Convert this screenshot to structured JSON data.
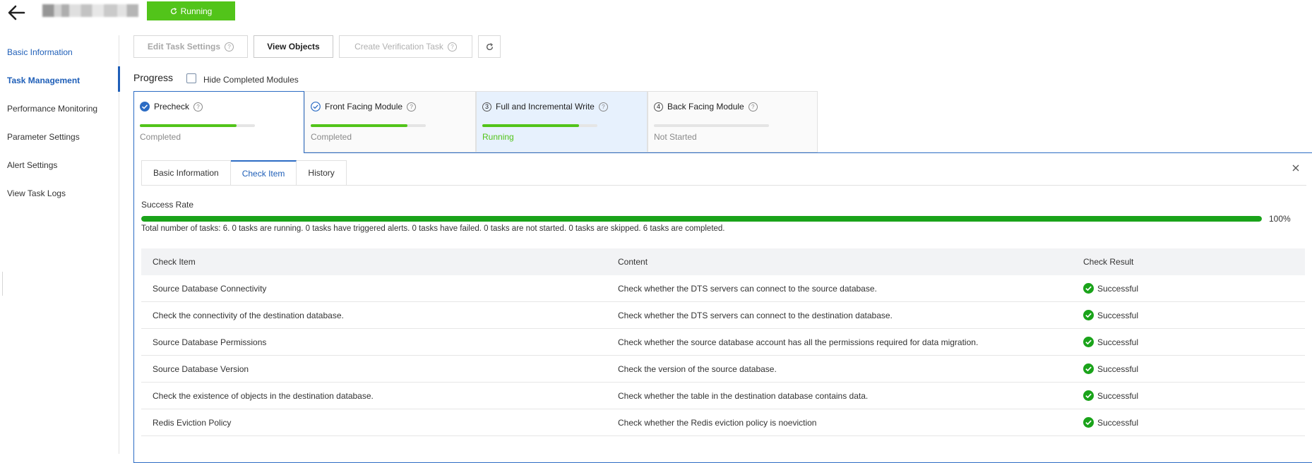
{
  "header": {
    "status": "Running"
  },
  "sidebar": {
    "items": [
      {
        "label": "Basic Information"
      },
      {
        "label": "Task Management"
      },
      {
        "label": "Performance Monitoring"
      },
      {
        "label": "Parameter Settings"
      },
      {
        "label": "Alert Settings"
      },
      {
        "label": "View Task Logs"
      }
    ]
  },
  "toolbar": {
    "edit_label": "Edit Task Settings",
    "view_label": "View Objects",
    "create_label": "Create Verification Task"
  },
  "progress": {
    "title": "Progress",
    "hide_label": "Hide Completed Modules",
    "hide_checked": false,
    "steps": [
      {
        "label": "Precheck",
        "status": "Completed",
        "percent": 100
      },
      {
        "label": "Front Facing Module",
        "status": "Completed",
        "percent": 100
      },
      {
        "number": "3",
        "label": "Full and Incremental Write",
        "status": "Running",
        "percent": 100
      },
      {
        "number": "4",
        "label": "Back Facing Module",
        "status": "Not Started",
        "percent": 0
      }
    ]
  },
  "panel": {
    "tabs": [
      "Basic Information",
      "Check Item",
      "History"
    ],
    "active_tab": "Check Item",
    "success_rate_label": "Success Rate",
    "success_rate_value": "100%",
    "success_rate_percent": 100,
    "summary": "Total number of tasks: 6. 0 tasks are running. 0 tasks have triggered alerts. 0 tasks have failed. 0 tasks are not started. 0 tasks are skipped. 6 tasks are completed.",
    "columns": [
      "Check Item",
      "Content",
      "Check Result"
    ],
    "rows": [
      {
        "item": "Source Database Connectivity",
        "content": "Check whether the DTS servers can connect to the source database.",
        "result": "Successful"
      },
      {
        "item": "Check the connectivity of the destination database.",
        "content": "Check whether the DTS servers can connect to the destination database.",
        "result": "Successful"
      },
      {
        "item": "Source Database Permissions",
        "content": "Check whether the source database account has all the permissions required for data migration.",
        "result": "Successful"
      },
      {
        "item": "Source Database Version",
        "content": "Check the version of the source database.",
        "result": "Successful"
      },
      {
        "item": "Check the existence of objects in the destination database.",
        "content": "Check whether the table in the destination database contains data.",
        "result": "Successful"
      },
      {
        "item": "Redis Eviction Policy",
        "content": "Check whether the Redis eviction policy is noeviction",
        "result": "Successful"
      }
    ]
  },
  "colors": {
    "accent": "#1f5fb8",
    "success": "#52c41a",
    "success_dark": "#1aa31a",
    "border_active": "#2c6cc4"
  },
  "icons": [
    "back-arrow-icon",
    "refresh-icon",
    "help-icon",
    "check-circle-icon",
    "close-icon"
  ]
}
